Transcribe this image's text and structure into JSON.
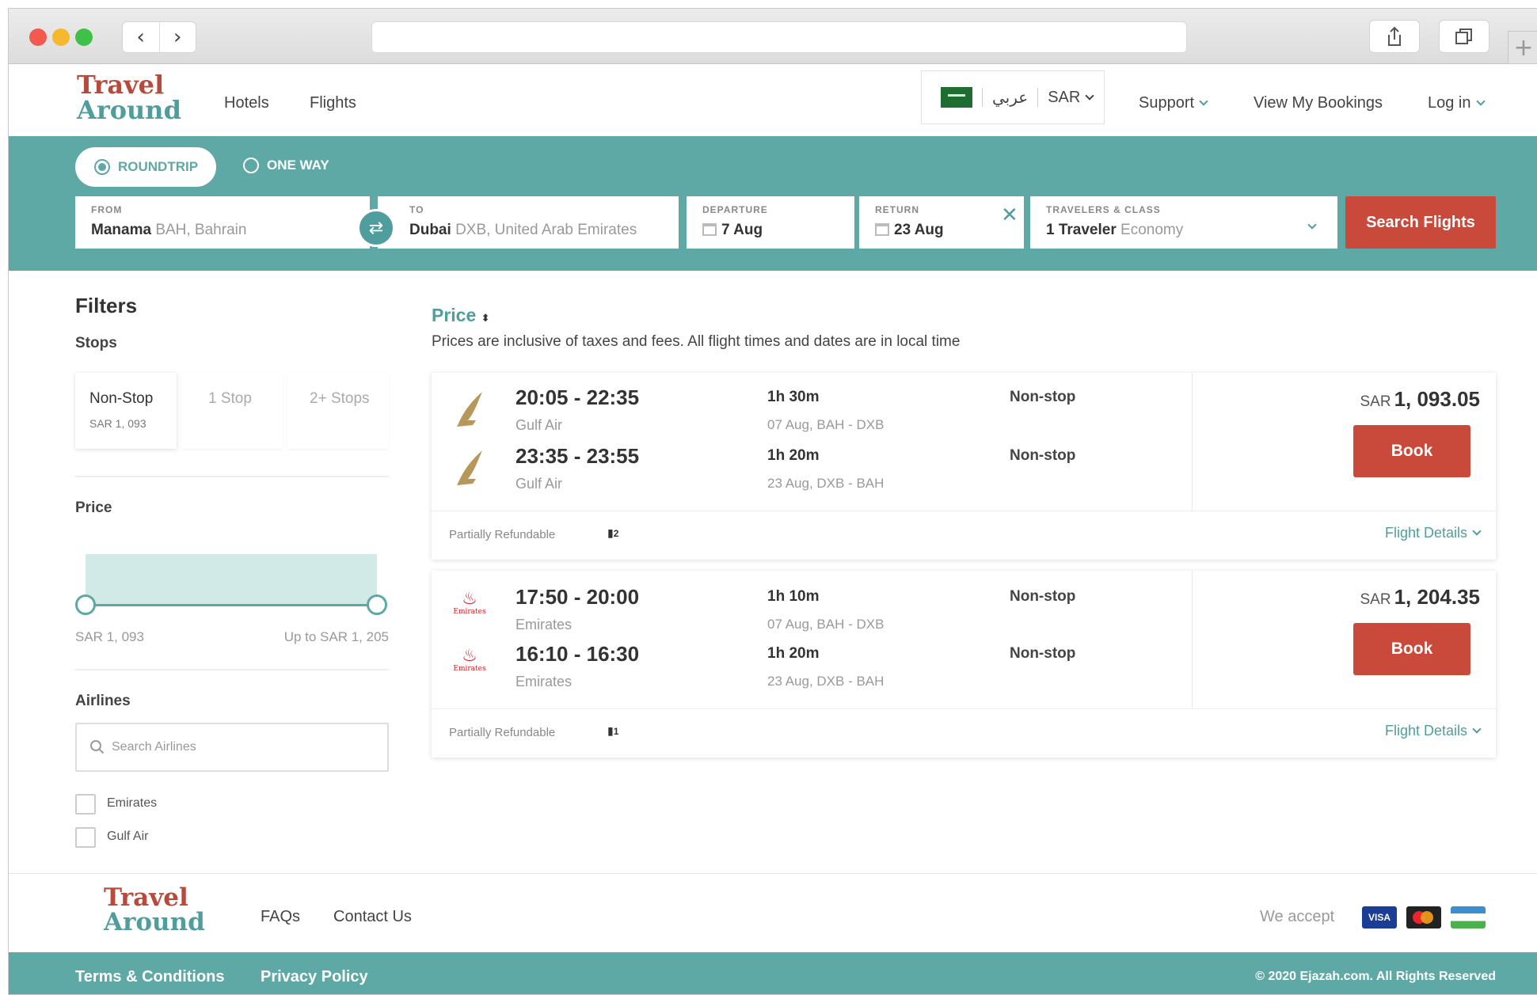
{
  "brand": {
    "line1": "Travel",
    "line2": "Around"
  },
  "nav": {
    "hotels": "Hotels",
    "flights": "Flights",
    "arabic": "عربي",
    "currency": "SAR",
    "support": "Support",
    "bookings": "View My Bookings",
    "login": "Log in"
  },
  "search": {
    "roundtrip": "ROUNDTRIP",
    "oneway": "ONE WAY",
    "from_label": "FROM",
    "from_city": "Manama",
    "from_detail": "BAH, Bahrain",
    "to_label": "TO",
    "to_city": "Dubai",
    "to_detail": "DXB, United Arab Emirates",
    "dep_label": "DEPARTURE",
    "dep_value": "7 Aug",
    "ret_label": "RETURN",
    "ret_value": "23 Aug",
    "trav_label": "TRAVELERS & CLASS",
    "trav_value": "1 Traveler",
    "trav_class": "Economy",
    "button": "Search Flights"
  },
  "filters": {
    "title": "Filters",
    "stops_title": "Stops",
    "stops": [
      {
        "label": "Non-Stop",
        "price": "SAR 1, 093"
      },
      {
        "label": "1 Stop"
      },
      {
        "label": "2+ Stops"
      }
    ],
    "price_title": "Price",
    "price_min": "SAR 1, 093",
    "price_max": "Up to SAR 1, 205",
    "airlines_title": "Airlines",
    "airlines_placeholder": "Search Airlines",
    "airlines": [
      "Emirates",
      "Gulf Air"
    ]
  },
  "results": {
    "sort_label": "Price",
    "note": "Prices are inclusive of taxes and fees. All flight times and dates are in local time",
    "cards": [
      {
        "price_currency": "SAR",
        "price_value": "1, 093.05",
        "book": "Book",
        "refund": "Partially Refundable",
        "bags": "2",
        "details": "Flight Details",
        "legs": [
          {
            "time": "20:05 - 22:35",
            "airline": "Gulf Air",
            "duration": "1h 30m",
            "route": "07 Aug, BAH - DXB",
            "stops": "Non-stop"
          },
          {
            "time": "23:35 - 23:55",
            "airline": "Gulf Air",
            "duration": "1h 20m",
            "route": "23 Aug, DXB - BAH",
            "stops": "Non-stop"
          }
        ]
      },
      {
        "price_currency": "SAR",
        "price_value": "1, 204.35",
        "book": "Book",
        "refund": "Partially Refundable",
        "bags": "1",
        "details": "Flight Details",
        "legs": [
          {
            "time": "17:50 - 20:00",
            "airline": "Emirates",
            "duration": "1h 10m",
            "route": "07 Aug, BAH - DXB",
            "stops": "Non-stop"
          },
          {
            "time": "16:10 - 16:30",
            "airline": "Emirates",
            "duration": "1h 20m",
            "route": "23 Aug, DXB - BAH",
            "stops": "Non-stop"
          }
        ]
      }
    ]
  },
  "footer": {
    "faqs": "FAQs",
    "contact": "Contact Us",
    "we_accept": "We accept",
    "terms": "Terms & Conditions",
    "privacy": "Privacy Policy",
    "copyright": "© 2020 Ejazah.com. All Rights Reserved"
  },
  "colors": {
    "teal": "#5ea8a5",
    "red": "#c9493a",
    "brand_red": "#b84a3b"
  }
}
